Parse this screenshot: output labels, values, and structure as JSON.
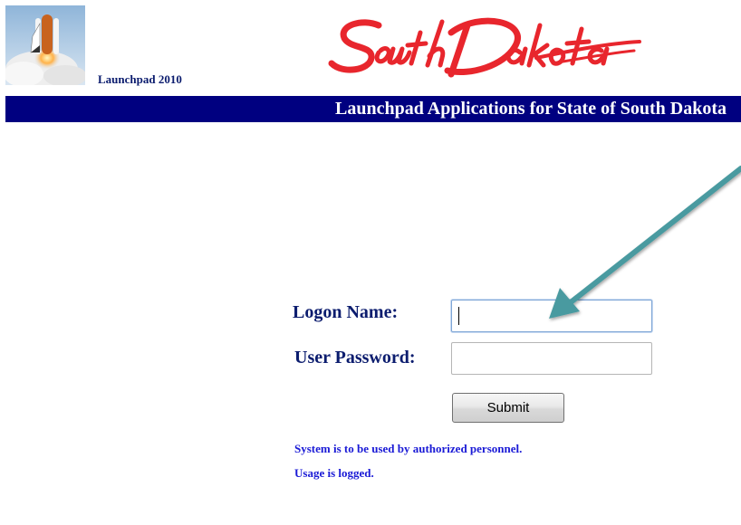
{
  "header": {
    "app_version": "Launchpad 2010",
    "state_logo_text": "SouthDakota",
    "banner_title": "Launchpad Applications for State of South Dakota"
  },
  "login_form": {
    "logon_name_label": "Logon Name:",
    "logon_name_value": "",
    "password_label": "User Password:",
    "password_value": "",
    "submit_label": "Submit"
  },
  "notices": {
    "line1": "System is to be used by authorized personnel.",
    "line2": "Usage is logged."
  },
  "colors": {
    "banner": "#000080",
    "label_text": "#0b1c6e",
    "notice_text": "#1a1ad6",
    "logo_red": "#e8262d",
    "arrow": "#4a9aa0"
  },
  "icons": {
    "shuttle": "space-shuttle-logo",
    "arrow": "annotation-arrow"
  }
}
